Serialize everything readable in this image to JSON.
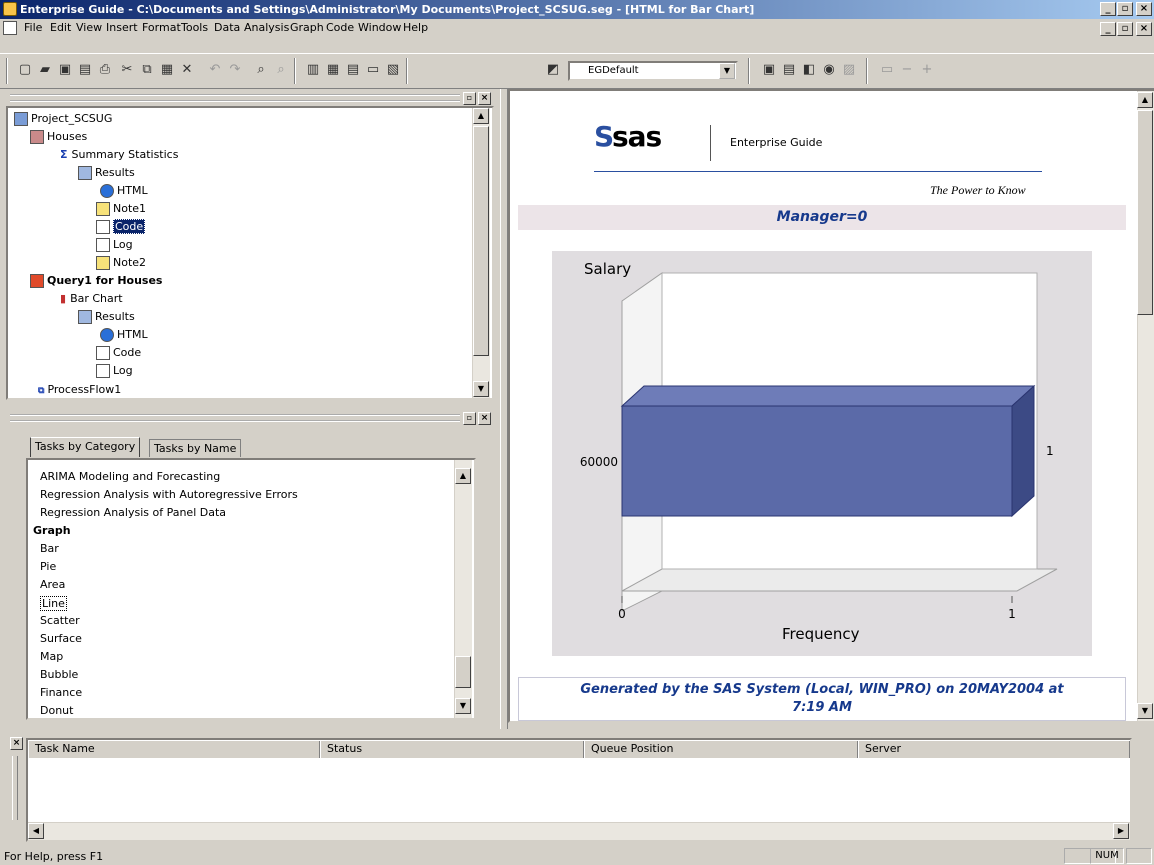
{
  "window": {
    "title": "Enterprise Guide - C:\\Documents and Settings\\Administrator\\My Documents\\Project_SCSUG.seg - [HTML for Bar Chart]"
  },
  "menu": [
    "File",
    "Edit",
    "View",
    "Insert",
    "Format",
    "Tools",
    "Data",
    "Analysis",
    "Graph",
    "Code",
    "Window",
    "Help"
  ],
  "toolbar": {
    "style_value": "EGDefault"
  },
  "project_tree": {
    "root": "Project_SCSUG",
    "houses": "Houses",
    "summary_stats": "Summary Statistics",
    "results1": "Results",
    "html1": "HTML",
    "note1": "Note1",
    "code1": "Code",
    "log1": "Log",
    "note2": "Note2",
    "query": "Query1 for Houses",
    "bar_chart": "Bar Chart",
    "results2": "Results",
    "html2": "HTML",
    "code2": "Code",
    "log2": "Log",
    "process_flow": "ProcessFlow1"
  },
  "tasks": {
    "tab_category": "Tasks by Category",
    "tab_name": "Tasks by Name",
    "items": [
      "ARIMA Modeling and Forecasting",
      "Regression Analysis with Autoregressive Errors",
      "Regression Analysis of Panel Data",
      "Graph",
      "Bar",
      "Pie",
      "Area",
      "Line",
      "Scatter",
      "Surface",
      "Map",
      "Bubble",
      "Finance",
      "Donut"
    ]
  },
  "report": {
    "brand": "sas",
    "product": "Enterprise Guide",
    "tagline": "The Power to Know",
    "byline": "Manager=0",
    "footer_line1": "Generated by the SAS System (Local, WIN_PRO) on 20MAY2004 at",
    "footer_line2": "7:19 AM"
  },
  "chart_data": {
    "type": "bar",
    "orientation": "horizontal",
    "categories": [
      "60000"
    ],
    "values": [
      1
    ],
    "data_labels": [
      "1"
    ],
    "ylabel": "Salary",
    "xlabel": "Frequency",
    "xlim": [
      0,
      1
    ],
    "x_ticks": [
      "0",
      "1"
    ],
    "colors": {
      "bar": "#5b6aa8",
      "bar_side": "#3c4a85",
      "bar_top": "#6e7cb8",
      "panel": "#e0dde0"
    }
  },
  "task_status": {
    "columns": [
      "Task Name",
      "Status",
      "Queue Position",
      "Server"
    ]
  },
  "statusbar": {
    "help": "For Help, press F1",
    "num": "NUM"
  }
}
